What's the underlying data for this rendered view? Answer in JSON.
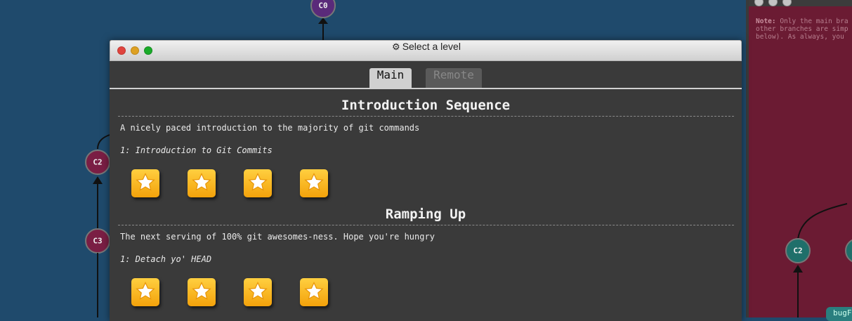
{
  "background": {
    "commits": [
      {
        "id": "c0",
        "label": "C0"
      },
      {
        "id": "c2",
        "label": "C2"
      },
      {
        "id": "c3",
        "label": "C3"
      }
    ],
    "goal": {
      "note_label": "Note:",
      "note_line1": " Only the main bra",
      "note_line2": "other branches are simp",
      "note_line3": "below). As always, you",
      "commit_label": "C2",
      "branch_tag": "bugF"
    }
  },
  "modal": {
    "title": "Select a level",
    "tabs": [
      {
        "label": "Main",
        "selected": true
      },
      {
        "label": "Remote",
        "selected": false
      }
    ],
    "sequences": [
      {
        "title": "Introduction Sequence",
        "description": "A nicely paced introduction to the majority of git commands",
        "level": "1: Introduction to Git Commits",
        "stars": 4
      },
      {
        "title": "Ramping Up",
        "description": "The next serving of 100% git awesomes-ness. Hope you're hungry",
        "level": "1: Detach yo' HEAD",
        "stars": 4
      }
    ]
  },
  "colors": {
    "background": "#1f4a6c",
    "modal": "#3a3a3a",
    "star": "#f6ae17",
    "goal_panel": "#6b1b33"
  }
}
